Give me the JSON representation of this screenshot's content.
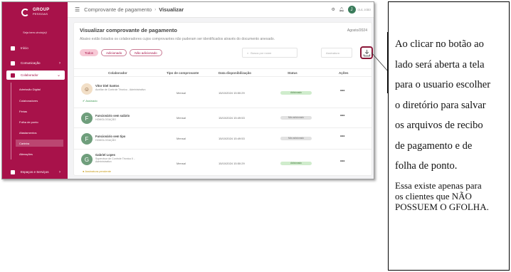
{
  "app": {
    "logo_top": "GROUP",
    "logo_bottom": "PESSOAS",
    "welcome": "Seja bem-vindo(a)!"
  },
  "sidebar": {
    "items": [
      {
        "label": "Início"
      },
      {
        "label": "Comunicação"
      },
      {
        "label": "Colaborador"
      },
      {
        "label": "Espaços e Serviços"
      }
    ],
    "subitems": [
      {
        "label": "Admissão Digital"
      },
      {
        "label": "Colaboradores"
      },
      {
        "label": "Férias"
      },
      {
        "label": "Folha de ponto"
      },
      {
        "label": "Afastamentos"
      },
      {
        "label": "Carteira"
      },
      {
        "label": "Alterações"
      }
    ]
  },
  "topbar": {
    "breadcrumb_1": "Comprovante de pagamento",
    "breadcrumb_sep": "›",
    "breadcrumb_2": "Visualizar",
    "avatar_letter": "J",
    "user_name": "OLÁ, JOÃO"
  },
  "page": {
    "title": "Visualizar comprovante de pagamento",
    "period": "Agosto/2024",
    "subtitle": "Abaixo estão listados os colaboradores cujos comprovantes não puderam ser identificados através do documento anexado.",
    "filters": [
      "Todos",
      "Adicionado",
      "Não adicionado"
    ],
    "search_placeholder": "Busca por nome",
    "select_placeholder": "Assinatura"
  },
  "table": {
    "headers": [
      "Colaborador",
      "Tipo de comprovante",
      "Data disponibilização",
      "Status",
      "Ações"
    ],
    "rows": [
      {
        "avatar": "",
        "name": "Vitor Diel Santos",
        "role": "Auxiliar de Controle Técnico - Administrativo",
        "note": "Assinado",
        "type": "Mensal",
        "date": "15/10/2024 15:50:29",
        "status": "Adicionado",
        "actions": "•••"
      },
      {
        "avatar": "F",
        "name": "Funcionário sem salário",
        "role": "HOMOLOGAÇÃO",
        "note": "",
        "type": "Mensal",
        "date": "15/10/2024 15:49:53",
        "status": "Não adicionado",
        "actions": "•••"
      },
      {
        "avatar": "F",
        "name": "Funcionário sem tipo",
        "role": "HOMOLOGAÇÃO",
        "note": "",
        "type": "Mensal",
        "date": "15/10/2024 15:49:53",
        "status": "Não adicionado",
        "actions": "•••"
      },
      {
        "avatar": "G",
        "name": "Gabriel Lopes",
        "role": "Supervisor de Controle Técnico II - Administrativo",
        "note": "Assinatura pendente",
        "type": "Mensal",
        "date": "15/10/2024 15:50:29",
        "status": "Adicionado",
        "actions": "•••"
      }
    ]
  },
  "annotation": {
    "main_lines": [
      "Ao clicar  no botão ao",
      "lado será aberta a tela",
      "para o usuario  escolher",
      "o diretório  para salvar",
      "os arquivos  de recibo",
      "de pagamento  e de",
      "folha  de ponto."
    ],
    "sub_lines": [
      "Essa existe apenas para",
      "os clientes que NÃO",
      "POSSUEM O GFOLHA."
    ]
  },
  "colors": {
    "brand": "#a8124a",
    "callout_border": "#8a1738",
    "success": "#cfeccc"
  },
  "icons": [
    "menu-icon",
    "home-icon",
    "chat-icon",
    "id-card-icon",
    "building-icon",
    "search-icon",
    "download-icon",
    "bell-icon",
    "settings-icon"
  ]
}
